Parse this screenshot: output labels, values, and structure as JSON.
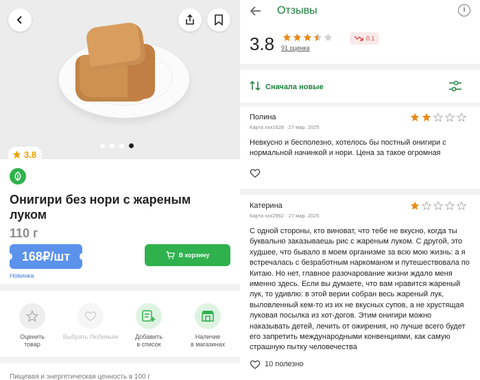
{
  "product": {
    "rating": "3.8",
    "title": "Онигири без нори с жареным луком",
    "weight": "110 г",
    "price": "168₽/шт",
    "badge": "Новинка",
    "cart_label": "В корзину",
    "image_dots": 4,
    "image_active_dot": 4
  },
  "actions": [
    {
      "label": "Оценить\nтовар",
      "icon": "star-icon"
    },
    {
      "label": "Выбрать Любимым",
      "icon": "heart-icon"
    },
    {
      "label": "Добавить\nв список",
      "icon": "add-to-list-icon"
    },
    {
      "label": "Наличие\nв магазинах",
      "icon": "store-icon"
    }
  ],
  "nutrition_heading": "Пищевая и энергетическая ценность в 100 г",
  "reviews_page": {
    "title": "Отзывы",
    "info_icon": "info-icon",
    "summary": {
      "rating": "3.8",
      "stars": 3.5,
      "count_label": "91 оценка",
      "trend": "0.1",
      "trend_direction": "down"
    },
    "sort_label": "Сначала новые",
    "reviews": [
      {
        "author": "Полина",
        "meta": "Карта xxx1628 · 27 мар. 2025",
        "stars": 2,
        "text": "Невкусно и бесполезно, хотелось бы постный онигири с нормальной начинкой и нори. Цена за такое огромная",
        "useful": ""
      },
      {
        "author": "Катерина",
        "meta": "Карта xxx2962 · 27 мар. 2025",
        "stars": 1,
        "text": "С одной стороны, кто виноват, что тебе не вкусно, когда ты буквально заказываешь рис с жареным луком. С другой, это худшее, что бывало в моем организме за всю мою жизнь: а я встречалась с безработным наркоманом и путешествовала по Китаю. Но нет, главное разочарование жизни ждало меня именно здесь. Если вы думаете, что вам нравится жареный лук, то удивлю: в этой верии собран весь жареный лук, выловленный кем-то из их не вкусных супов, а не хрустящая луковая посылка из хот-догов. Этим онигири можно наказывать детей, лечить от ожирения, но лучше всего будет его запретить международными конвенциями, как самую страшную пытку человечества",
        "useful": "10 полезно"
      }
    ]
  },
  "colors": {
    "green": "#2fb24e",
    "dark_green": "#1a7f3a",
    "price_blue": "#5b92ec",
    "star_orange": "#e8891a",
    "star_empty": "#cccccc"
  }
}
